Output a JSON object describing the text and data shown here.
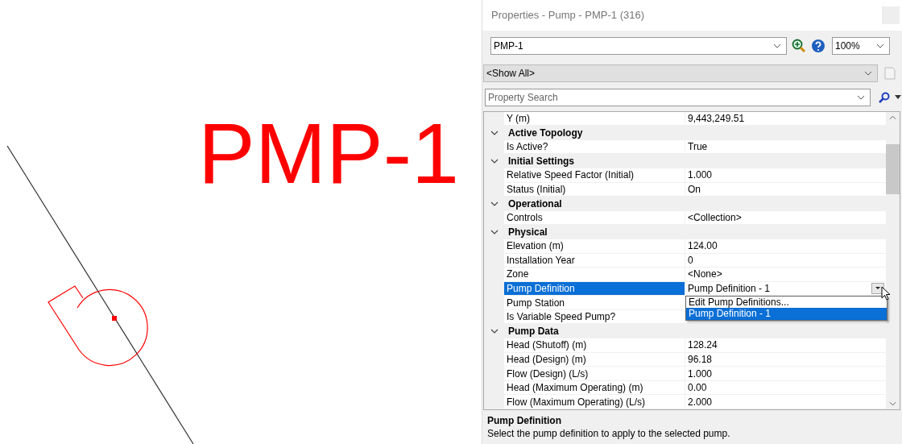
{
  "canvas": {
    "label": "PMP-1"
  },
  "panel": {
    "title": "Properties - Pump - PMP-1 (316)",
    "element_combo": {
      "value": "PMP-1"
    },
    "zoom_combo": {
      "value": "100%"
    },
    "filter_combo": {
      "value": "<Show All>"
    },
    "search": {
      "placeholder": "Property Search"
    }
  },
  "grid": {
    "rows": [
      {
        "kind": "property",
        "label": "Y (m)",
        "value": "9,443,249.51",
        "selected": false
      },
      {
        "kind": "category",
        "label": "Active Topology",
        "expanded": true
      },
      {
        "kind": "property",
        "label": "Is Active?",
        "value": "True",
        "selected": false
      },
      {
        "kind": "category",
        "label": "Initial Settings",
        "expanded": true
      },
      {
        "kind": "property",
        "label": "Relative Speed Factor (Initial)",
        "value": "1.000",
        "selected": false
      },
      {
        "kind": "property",
        "label": "Status (Initial)",
        "value": "On",
        "selected": false
      },
      {
        "kind": "category",
        "label": "Operational",
        "expanded": true
      },
      {
        "kind": "property",
        "label": "Controls",
        "value": "<Collection>",
        "selected": false
      },
      {
        "kind": "category",
        "label": "Physical",
        "expanded": true
      },
      {
        "kind": "property",
        "label": "Elevation (m)",
        "value": "124.00",
        "selected": false
      },
      {
        "kind": "property",
        "label": "Installation Year",
        "value": "0",
        "selected": false
      },
      {
        "kind": "property",
        "label": "Zone",
        "value": "<None>",
        "selected": false
      },
      {
        "kind": "property",
        "label": "Pump Definition",
        "value": "Pump Definition - 1",
        "selected": true,
        "dropdown": {
          "options": [
            {
              "label": "Edit Pump Definitions...",
              "selected": false
            },
            {
              "label": "Pump Definition - 1",
              "selected": true
            }
          ]
        }
      },
      {
        "kind": "property",
        "label": "Pump Station",
        "selected": false
      },
      {
        "kind": "property",
        "label": "Is Variable Speed Pump?",
        "selected": false
      },
      {
        "kind": "category",
        "label": "Pump Data",
        "expanded": true
      },
      {
        "kind": "property",
        "label": "Head (Shutoff) (m)",
        "value": "128.24",
        "selected": false
      },
      {
        "kind": "property",
        "label": "Head (Design) (m)",
        "value": "96.18",
        "selected": false
      },
      {
        "kind": "property",
        "label": "Flow (Design) (L/s)",
        "value": "1.000",
        "selected": false
      },
      {
        "kind": "property",
        "label": "Head (Maximum Operating) (m)",
        "value": "0.00",
        "selected": false
      },
      {
        "kind": "property",
        "label": "Flow (Maximum Operating) (L/s)",
        "value": "2.000",
        "selected": false
      }
    ]
  },
  "help": {
    "title": "Pump Definition",
    "text": "Select the pump definition to apply to the selected pump."
  }
}
